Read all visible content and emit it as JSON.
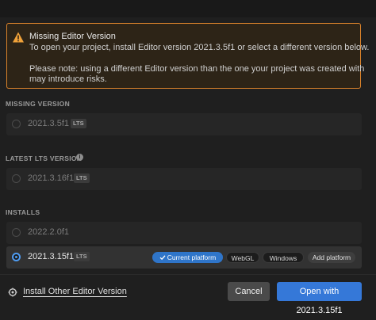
{
  "warning": {
    "title": "Missing Editor Version",
    "line1": "To open your project, install Editor version 2021.3.5f1 or select a different version below.",
    "line2": "Please note: using a different Editor version than the one your project was created with",
    "line3": "may introduce risks.",
    "icon": "warning-triangle-icon",
    "accent": "#d9822b"
  },
  "missing": {
    "label": "MISSING VERSION",
    "item": {
      "version": "2021.3.5f1",
      "badge": "LTS"
    }
  },
  "latest": {
    "label": "LATEST LTS VERSION",
    "info_icon": "i",
    "item": {
      "version": "2021.3.16f1",
      "badge": "LTS"
    }
  },
  "installs": {
    "label": "INSTALLS",
    "items": [
      {
        "version": "2022.2.0f1"
      },
      {
        "version": "2021.3.15f1",
        "badge": "LTS",
        "selected": true,
        "platforms": {
          "current": "Current platform",
          "webgl": "WebGL",
          "windows": "Windows",
          "add": "Add platform"
        }
      }
    ]
  },
  "footer": {
    "install_other": "Install Other Editor Version",
    "cancel": "Cancel",
    "open": "Open with 2021.3.15f1"
  },
  "colors": {
    "background": "#1f1f1f",
    "primary": "#3578d8",
    "selected_radio": "#4f9cf2"
  }
}
